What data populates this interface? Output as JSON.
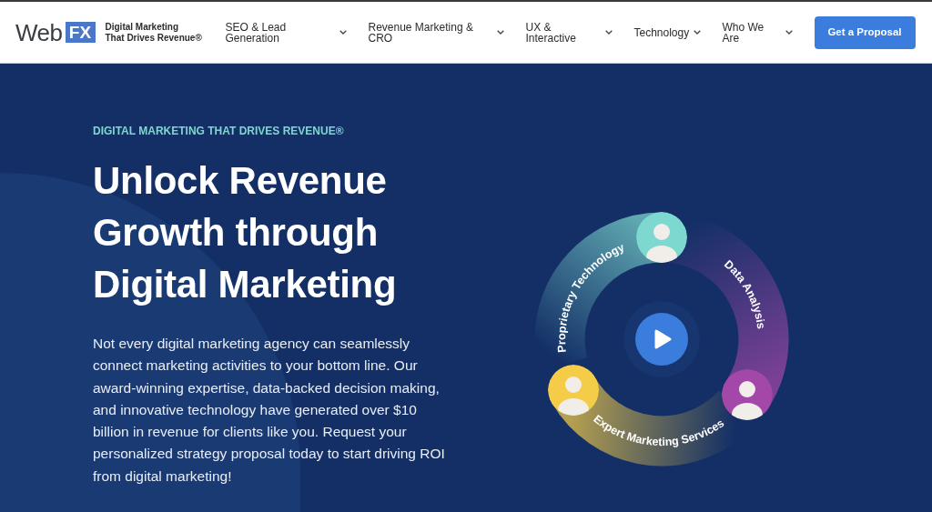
{
  "header": {
    "logo": {
      "wordmark": "Web",
      "badge": "FX"
    },
    "tagline": [
      "Digital Marketing",
      "That Drives Revenue®"
    ],
    "nav": [
      {
        "label": "SEO & Lead Generation"
      },
      {
        "label": "Revenue Marketing & CRO"
      },
      {
        "label": "UX & Interactive"
      },
      {
        "label": "Technology"
      },
      {
        "label": "Who We Are"
      }
    ],
    "cta": "Get a Proposal"
  },
  "hero": {
    "eyebrow": "DIGITAL MARKETING THAT DRIVES REVENUE®",
    "headline": "Unlock Revenue Growth through Digital Marketing",
    "body": "Not every digital marketing agency can seamlessly connect marketing activities to your bottom line. Our award-winning expertise, data-backed decision making, and innovative technology have generated over $10 billion in revenue for clients like you. Request your personalized strategy proposal today to start driving ROI from digital marketing!",
    "diagram": {
      "segments": [
        {
          "label": "Proprietary Technology",
          "color": "#7dd8cf"
        },
        {
          "label": "Data Analysis",
          "color": "#a347a9"
        },
        {
          "label": "Expert Marketing Services",
          "color": "#f4cc48"
        }
      ]
    }
  }
}
